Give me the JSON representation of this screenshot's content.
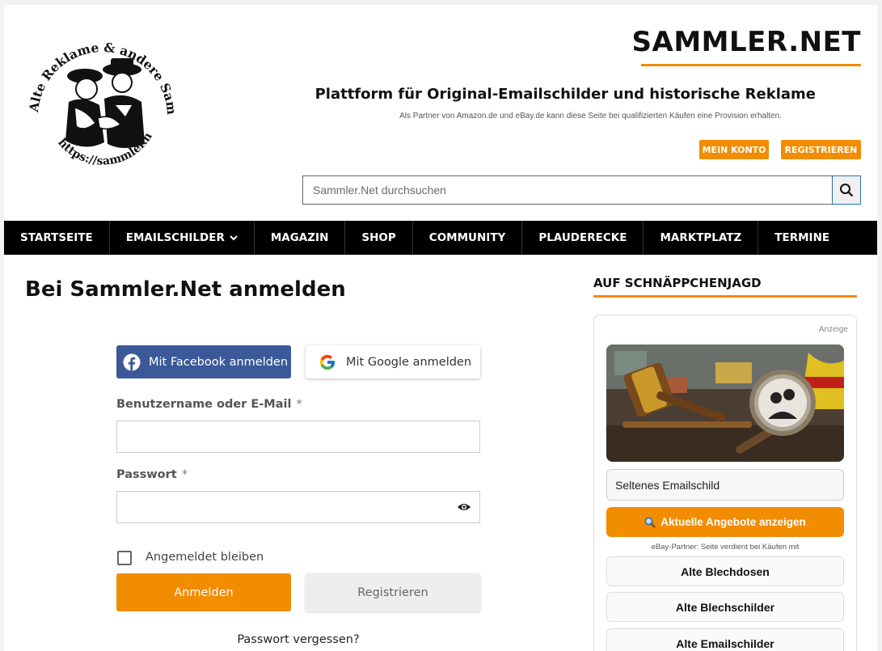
{
  "header": {
    "logo_text_top": "Alte Reklame & andere Sammelobjekte",
    "logo_text_bottom": "https://sammler.net",
    "site_title": "SAMMLER.NET",
    "tagline": "Plattform für Original-Emailschilder und historische Reklame",
    "disclaimer": "Als Partner von Amazon.de und eBay.de kann diese Seite bei qualifizierten Käufen eine Provision erhalten.",
    "my_account_label": "MEIN KONTO",
    "register_label": "REGISTRIEREN",
    "search_placeholder": "Sammler.Net durchsuchen",
    "search_icon": "search-icon"
  },
  "nav": {
    "items": [
      {
        "label": "STARTSEITE"
      },
      {
        "label": "EMAILSCHILDER",
        "has_dropdown": true
      },
      {
        "label": "MAGAZIN"
      },
      {
        "label": "SHOP"
      },
      {
        "label": "COMMUNITY"
      },
      {
        "label": "PLAUDERECKE"
      },
      {
        "label": "MARKTPLATZ"
      },
      {
        "label": "TERMINE"
      }
    ]
  },
  "login": {
    "heading": "Bei Sammler.Net anmelden",
    "facebook_label": "Mit Facebook anmelden",
    "google_label": "Mit Google anmelden",
    "username_label": "Benutzername oder E-Mail",
    "password_label": "Passwort",
    "required_marker": "*",
    "username_value": "",
    "password_value": "",
    "remember_label": "Angemeldet bleiben",
    "remember_checked": false,
    "submit_label": "Anmelden",
    "register_label": "Registrieren",
    "forgot_label": "Passwort vergessen?"
  },
  "sidebar": {
    "heading": "AUF SCHNÄPPCHENJAGD",
    "ad_label": "Anzeige",
    "search_value": "Seltenes Emailschild",
    "cta_label": "Aktuelle Angebote anzeigen",
    "partner_note": "eBay-Partner: Seite verdient bei Käufen mit",
    "links": [
      {
        "label": "Alte Blechdosen"
      },
      {
        "label": "Alte Blechschilder"
      },
      {
        "label": "Alte Emailschilder"
      }
    ]
  },
  "colors": {
    "accent": "#f28c00",
    "nav_bg": "#000000",
    "facebook": "#3b5998"
  }
}
